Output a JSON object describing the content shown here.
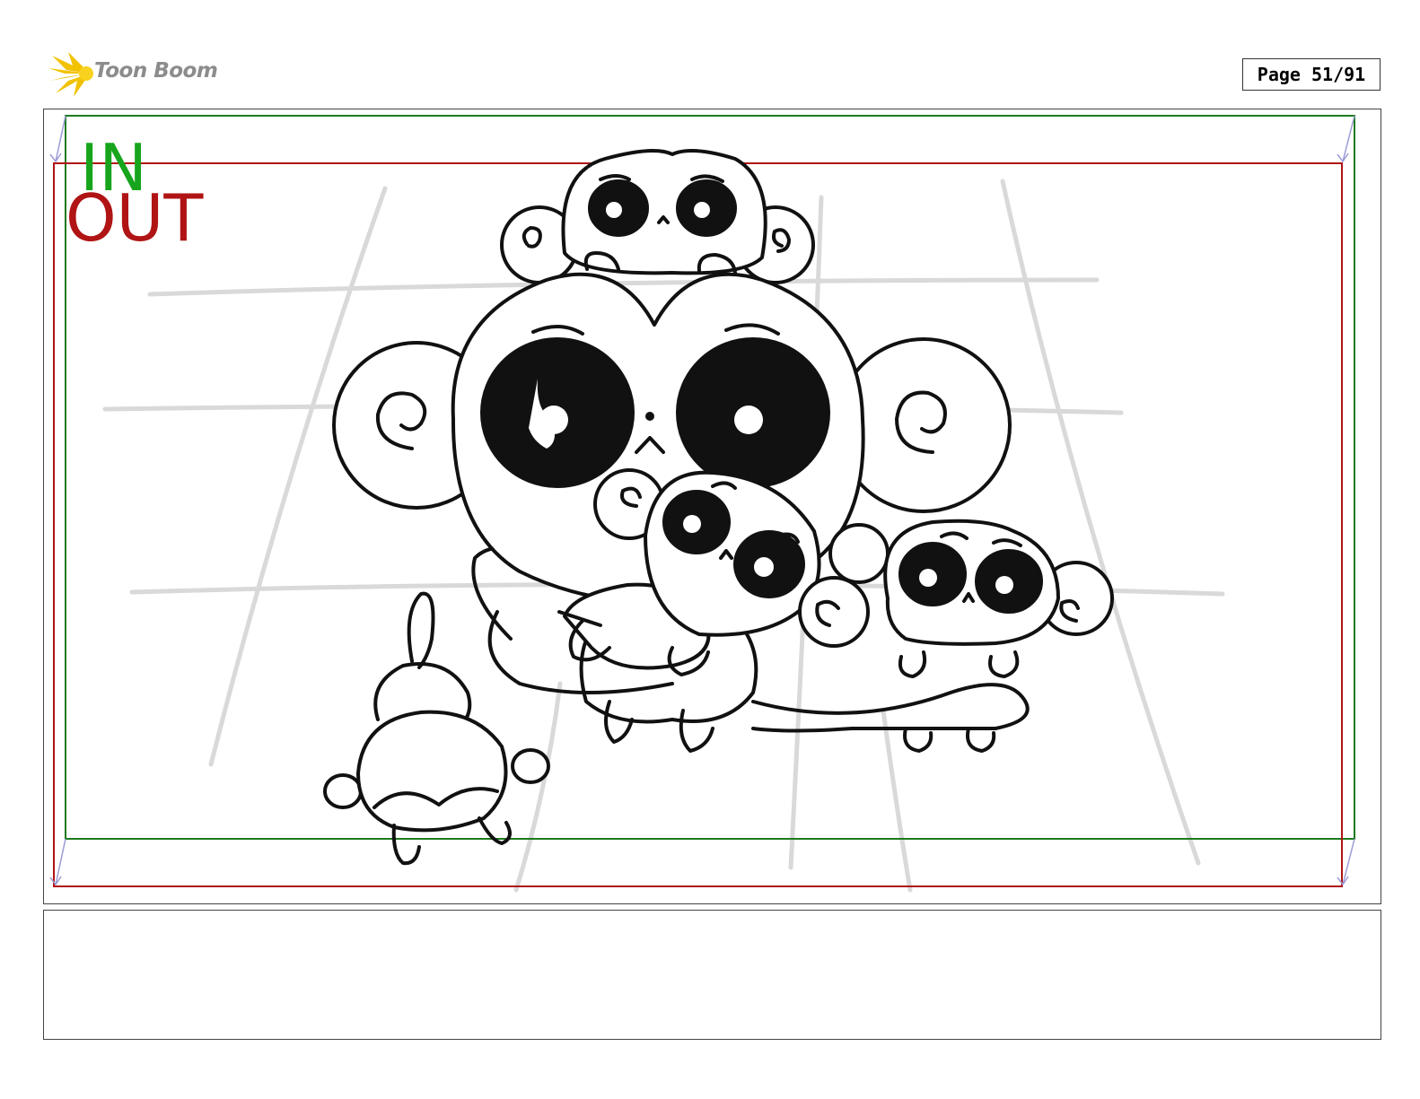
{
  "header": {
    "logo_text": "Toon Boom",
    "page_label": "Page 51/91"
  },
  "panel": {
    "in_label": "IN",
    "out_label": "OUT",
    "colors": {
      "in_frame": "#1e7a1e",
      "out_frame": "#b01414",
      "camera_arrows": "#9b9bd6",
      "background_guides": "#d8d8d8",
      "ink": "#111111"
    }
  },
  "caption": {
    "text": ""
  }
}
